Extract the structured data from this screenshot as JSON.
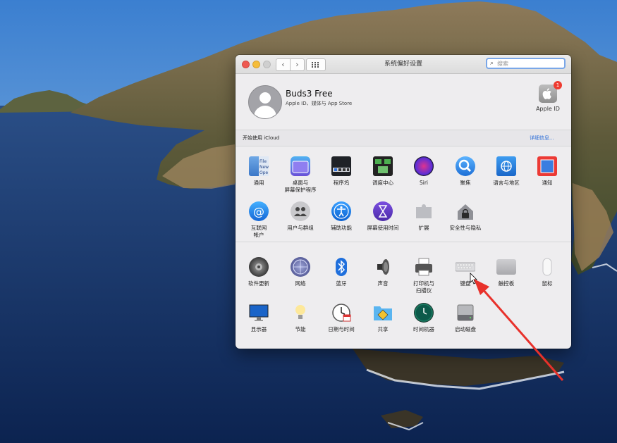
{
  "window": {
    "title": "系统偏好设置",
    "search_placeholder": "搜索"
  },
  "account": {
    "name": "Buds3 Free",
    "subtitle": "Apple ID、媒体与 App Store",
    "apple_id_label": "Apple ID",
    "apple_id_badge": "1"
  },
  "icloud": {
    "prompt": "开始使用 iCloud",
    "details_link": "详细信息..."
  },
  "panes_row1": [
    {
      "label": "通用",
      "icon": "general-icon"
    },
    {
      "label": "桌面与\n屏幕保护程序",
      "icon": "desktop-screensaver-icon"
    },
    {
      "label": "程序坞",
      "icon": "dock-icon"
    },
    {
      "label": "调度中心",
      "icon": "mission-control-icon"
    },
    {
      "label": "Siri",
      "icon": "siri-icon"
    },
    {
      "label": "聚焦",
      "icon": "spotlight-icon"
    },
    {
      "label": "语言与地区",
      "icon": "language-region-icon"
    },
    {
      "label": "通知",
      "icon": "notifications-icon"
    }
  ],
  "panes_row2": [
    {
      "label": "互联网\n帐户",
      "icon": "internet-accounts-icon"
    },
    {
      "label": "用户与群组",
      "icon": "users-groups-icon"
    },
    {
      "label": "辅助功能",
      "icon": "accessibility-icon"
    },
    {
      "label": "屏幕使用时间",
      "icon": "screen-time-icon"
    },
    {
      "label": "扩展",
      "icon": "extensions-icon"
    },
    {
      "label": "安全性与隐私",
      "icon": "security-privacy-icon"
    }
  ],
  "panes_row3": [
    {
      "label": "软件更新",
      "icon": "software-update-icon"
    },
    {
      "label": "网络",
      "icon": "network-icon"
    },
    {
      "label": "蓝牙",
      "icon": "bluetooth-icon"
    },
    {
      "label": "声音",
      "icon": "sound-icon"
    },
    {
      "label": "打印机与\n扫描仪",
      "icon": "printers-scanners-icon"
    },
    {
      "label": "键盘",
      "icon": "keyboard-icon"
    },
    {
      "label": "触控板",
      "icon": "trackpad-icon"
    },
    {
      "label": "鼠标",
      "icon": "mouse-icon"
    }
  ],
  "panes_row4": [
    {
      "label": "显示器",
      "icon": "displays-icon"
    },
    {
      "label": "节能",
      "icon": "energy-saver-icon"
    },
    {
      "label": "日期与时间",
      "icon": "date-time-icon"
    },
    {
      "label": "共享",
      "icon": "sharing-icon"
    },
    {
      "label": "时间机器",
      "icon": "time-machine-icon"
    },
    {
      "label": "启动磁盘",
      "icon": "startup-disk-icon"
    }
  ],
  "colors": {
    "accent_blue": "#2d6ed8",
    "annotation_red": "#e8312b",
    "badge_red": "#ee3b30"
  }
}
